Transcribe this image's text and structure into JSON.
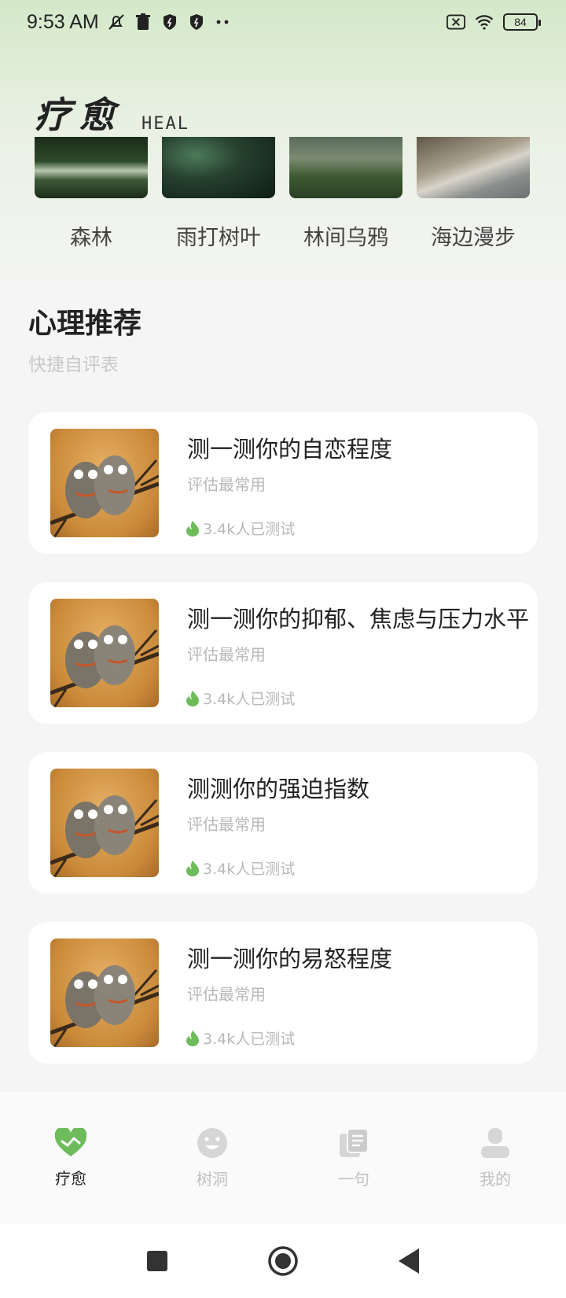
{
  "status_bar": {
    "time": "9:53 AM",
    "battery": "84",
    "icons": [
      "mute-icon",
      "trash-icon",
      "shield-icon",
      "shield-icon",
      "more-dots-icon",
      "sim-off-icon",
      "wifi-icon",
      "battery-icon"
    ]
  },
  "header": {
    "title_cn": "疗愈",
    "title_en": "HEAL"
  },
  "scenes": [
    {
      "label": "森林"
    },
    {
      "label": "雨打树叶"
    },
    {
      "label": "林间乌鸦"
    },
    {
      "label": "海边漫步"
    }
  ],
  "section": {
    "title": "心理推荐",
    "subtitle": "快捷自评表"
  },
  "cards": [
    {
      "title": "测一测你的自恋程度",
      "subtitle": "评估最常用",
      "count": "3.4k人已测试"
    },
    {
      "title": "测一测你的抑郁、焦虑与压力水平",
      "subtitle": "评估最常用",
      "count": "3.4k人已测试"
    },
    {
      "title": "测测你的强迫指数",
      "subtitle": "评估最常用",
      "count": "3.4k人已测试"
    },
    {
      "title": "测一测你的易怒程度",
      "subtitle": "评估最常用",
      "count": "3.4k人已测试"
    }
  ],
  "nav": [
    {
      "label": "疗愈",
      "icon": "heart-pulse-icon",
      "active": true
    },
    {
      "label": "树洞",
      "icon": "smiley-icon",
      "active": false
    },
    {
      "label": "一句",
      "icon": "notes-icon",
      "active": false
    },
    {
      "label": "我的",
      "icon": "user-icon",
      "active": false
    }
  ],
  "colors": {
    "accent": "#6dbb5a",
    "inactive": "#c0c0c0"
  }
}
